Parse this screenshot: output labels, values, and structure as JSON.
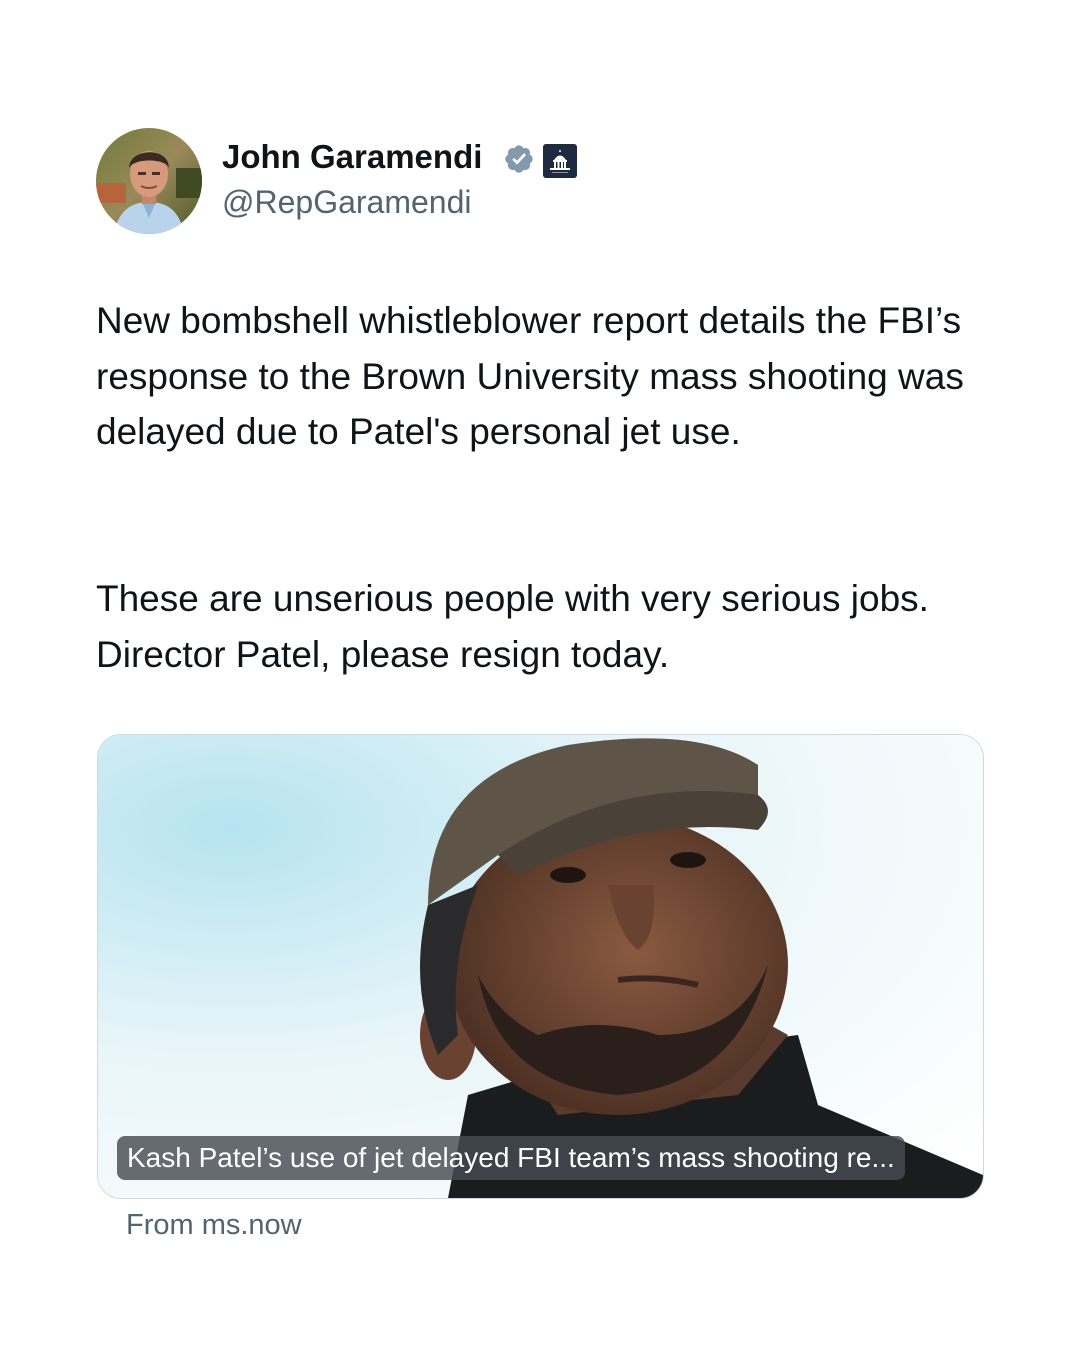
{
  "author": {
    "name": "John Garamendi",
    "handle": "@RepGaramendi",
    "verified_badge": "verified-check-icon",
    "affiliation_badge": "us-capitol-icon"
  },
  "tweet": {
    "paragraphs": [
      "New bombshell whistleblower report details the FBI’s response to the Brown University mass shooting was delayed due to Patel's personal jet use.",
      "These are unserious people with very serious jobs. Director Patel, please resign today."
    ]
  },
  "link_card": {
    "caption": "Kash Patel’s use of jet delayed FBI team’s mass shooting re...",
    "source": "From ms.now"
  },
  "colors": {
    "text": "#0f1419",
    "secondary_text": "#536471",
    "verified_badge": "#829aab",
    "card_border": "#cfd9de"
  }
}
